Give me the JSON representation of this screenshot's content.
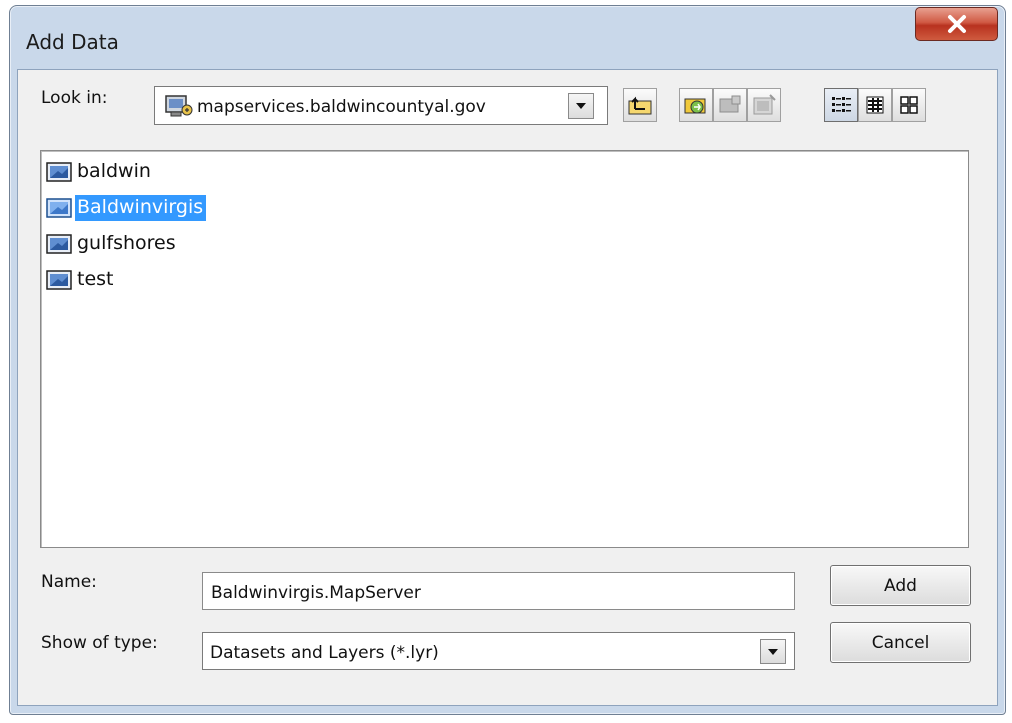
{
  "window": {
    "title": "Add Data",
    "close_icon": "close-x-icon"
  },
  "look_in": {
    "label": "Look in:",
    "value": "mapservices.baldwincountyal.gov",
    "icon": "server-connection-icon"
  },
  "toolbar": {
    "buttons": [
      {
        "name": "up-one-level",
        "icon": "up-folder-arrow-icon"
      },
      {
        "name": "connect-to-folder",
        "icon": "connect-folder-icon"
      },
      {
        "name": "disconnect",
        "icon": "disconnect-icon"
      },
      {
        "name": "new-item",
        "icon": "new-item-icon"
      },
      {
        "name": "list-view",
        "icon": "list-view-icon"
      },
      {
        "name": "details-view",
        "icon": "details-view-icon"
      },
      {
        "name": "thumbnails-view",
        "icon": "thumbnails-view-icon"
      }
    ]
  },
  "files": [
    {
      "label": "baldwin",
      "selected": false
    },
    {
      "label": "Baldwinvirgis",
      "selected": true
    },
    {
      "label": "gulfshores",
      "selected": false
    },
    {
      "label": "test",
      "selected": false
    }
  ],
  "name_field": {
    "label": "Name:",
    "value": "Baldwinvirgis.MapServer"
  },
  "type_field": {
    "label": "Show of type:",
    "value": "Datasets and Layers (*.lyr)"
  },
  "buttons": {
    "add": "Add",
    "cancel": "Cancel"
  },
  "colors": {
    "selection": "#3399ff",
    "frame": "#c9d8ea",
    "close": "#c8452e"
  }
}
